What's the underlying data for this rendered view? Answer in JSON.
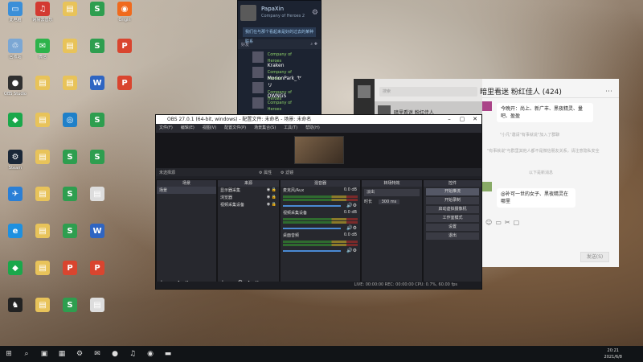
{
  "desktop": {
    "icons": [
      {
        "label": "此电脑",
        "glyph": "▭",
        "color": "#3b8fd8",
        "col": 0,
        "row": 0
      },
      {
        "label": "网易云音乐",
        "glyph": "♫",
        "color": "#d33a31",
        "col": 1,
        "row": 0
      },
      {
        "label": "",
        "glyph": "▤",
        "color": "#e8c35a",
        "col": 2,
        "row": 0
      },
      {
        "label": "",
        "glyph": "S",
        "color": "#2e9e4f",
        "col": 3,
        "row": 0
      },
      {
        "label": "Origin",
        "glyph": "◉",
        "color": "#f06a1d",
        "col": 4,
        "row": 0
      },
      {
        "label": "回收站",
        "glyph": "♲",
        "color": "#7ba7d4",
        "col": 0,
        "row": 1
      },
      {
        "label": "微信",
        "glyph": "✉",
        "color": "#2db34b",
        "col": 1,
        "row": 1
      },
      {
        "label": "",
        "glyph": "▤",
        "color": "#e8c35a",
        "col": 2,
        "row": 1
      },
      {
        "label": "",
        "glyph": "S",
        "color": "#2e9e4f",
        "col": 3,
        "row": 1
      },
      {
        "label": "",
        "glyph": "P",
        "color": "#d9452f",
        "col": 4,
        "row": 1
      },
      {
        "label": "OBS Studio",
        "glyph": "●",
        "color": "#303030",
        "col": 0,
        "row": 2
      },
      {
        "label": "",
        "glyph": "▤",
        "color": "#e8c35a",
        "col": 1,
        "row": 2
      },
      {
        "label": "",
        "glyph": "▤",
        "color": "#e8c35a",
        "col": 2,
        "row": 2
      },
      {
        "label": "",
        "glyph": "W",
        "color": "#2f65c2",
        "col": 3,
        "row": 2
      },
      {
        "label": "",
        "glyph": "P",
        "color": "#d9452f",
        "col": 4,
        "row": 2
      },
      {
        "label": "",
        "glyph": "◆",
        "color": "#1aa84b",
        "col": 0,
        "row": 3
      },
      {
        "label": "",
        "glyph": "▤",
        "color": "#e8c35a",
        "col": 1,
        "row": 3
      },
      {
        "label": "",
        "glyph": "◎",
        "color": "#1f80c9",
        "col": 2,
        "row": 3
      },
      {
        "label": "",
        "glyph": "S",
        "color": "#2e9e4f",
        "col": 3,
        "row": 3
      },
      {
        "label": "Steam",
        "glyph": "⚙",
        "color": "#1b2838",
        "col": 0,
        "row": 4
      },
      {
        "label": "",
        "glyph": "▤",
        "color": "#e8c35a",
        "col": 1,
        "row": 4
      },
      {
        "label": "",
        "glyph": "S",
        "color": "#2e9e4f",
        "col": 2,
        "row": 4
      },
      {
        "label": "",
        "glyph": "S",
        "color": "#2e9e4f",
        "col": 3,
        "row": 4
      },
      {
        "label": "",
        "glyph": "✈",
        "color": "#2a7fd6",
        "col": 0,
        "row": 5
      },
      {
        "label": "",
        "glyph": "▤",
        "color": "#e8c35a",
        "col": 1,
        "row": 5
      },
      {
        "label": "",
        "glyph": "S",
        "color": "#2e9e4f",
        "col": 2,
        "row": 5
      },
      {
        "label": "",
        "glyph": "▤",
        "color": "#dddddd",
        "col": 3,
        "row": 5
      },
      {
        "label": "",
        "glyph": "e",
        "color": "#1e90e0",
        "col": 0,
        "row": 6
      },
      {
        "label": "",
        "glyph": "▤",
        "color": "#e8c35a",
        "col": 1,
        "row": 6
      },
      {
        "label": "",
        "glyph": "S",
        "color": "#2e9e4f",
        "col": 2,
        "row": 6
      },
      {
        "label": "",
        "glyph": "W",
        "color": "#2f65c2",
        "col": 3,
        "row": 6
      },
      {
        "label": "",
        "glyph": "◆",
        "color": "#1aa84b",
        "col": 0,
        "row": 7
      },
      {
        "label": "",
        "glyph": "▤",
        "color": "#e8c35a",
        "col": 1,
        "row": 7
      },
      {
        "label": "",
        "glyph": "P",
        "color": "#d9452f",
        "col": 2,
        "row": 7
      },
      {
        "label": "",
        "glyph": "P",
        "color": "#d9452f",
        "col": 3,
        "row": 7
      },
      {
        "label": "",
        "glyph": "♞",
        "color": "#222222",
        "col": 0,
        "row": 8
      },
      {
        "label": "",
        "glyph": "▤",
        "color": "#e8c35a",
        "col": 1,
        "row": 8
      },
      {
        "label": "",
        "glyph": "S",
        "color": "#2e9e4f",
        "col": 2,
        "row": 8
      },
      {
        "label": "",
        "glyph": "▤",
        "color": "#dddddd",
        "col": 3,
        "row": 8
      }
    ]
  },
  "steam": {
    "username": "PapaXin",
    "status": "Company of Heroes 2",
    "notice": "我们在与那个看起来是好的过去的某种联系",
    "friends_header": "好友",
    "friends": [
      {
        "name": "",
        "game": "Company of Heroes"
      },
      {
        "name": "Kraken",
        "game": "Company of Heroes"
      },
      {
        "name": "MorionPark_ヤリ",
        "game": "Company of Heroes"
      },
      {
        "name": "OWNGS",
        "game": "Company of Heroes"
      }
    ]
  },
  "wechat": {
    "search_placeholder": "搜索",
    "chat_item": "暗里看迷 粉红佳人",
    "title": "暗里看迷 粉红佳人 (424)",
    "msg1": "今晚开：尚上、新广丰、黑夜精灵、量吧、盈盈",
    "sys1": "\"小凡\"邀请\"有事就说\"加入了群聊",
    "sys2": "\"有事就说\"与群里其他人都不是微信朋友关系，请注意隐私安全",
    "sys3": "以下是新消息",
    "msg2": "@补可一世的女子、黑夜精灵在哪里",
    "send_label": "发送(S)"
  },
  "obs": {
    "title": "OBS 27.0.1 (64-bit, windows) - 配置文件: 未命名 - 场景: 未命名",
    "menu": [
      "文件(F)",
      "编辑(E)",
      "视图(V)",
      "配置文件(P)",
      "场景集合(S)",
      "工具(T)",
      "帮助(H)"
    ],
    "no_source": "未选择源",
    "props_label": "属性",
    "filters_label": "滤镜",
    "docks": {
      "scenes": "场景",
      "sources": "来源",
      "mixer": "混音器",
      "transitions": "转场特效",
      "controls": "控件"
    },
    "scene_item": "场景",
    "sources_list": [
      "显示器采集",
      "浏览器",
      "视频采集设备"
    ],
    "mixer_tracks": [
      {
        "name": "麦克风/Aux",
        "db": "0.0 dB"
      },
      {
        "name": "视频采集设备",
        "db": "0.0 dB"
      },
      {
        "name": "桌面音频",
        "db": "0.0 dB"
      }
    ],
    "transition": "淡出",
    "duration_label": "时长",
    "duration_value": "300 ms",
    "controls": [
      "开始推流",
      "开始录制",
      "启动虚拟摄像机",
      "工作室模式",
      "设置",
      "退出"
    ],
    "status": "LIVE: 00:00:00   REC: 00:00:00   CPU: 0.7%, 60.00 fps"
  },
  "taskbar": {
    "time": "20:21",
    "date": "2021/6/8",
    "apps": [
      "⊞",
      "⌕",
      "▣",
      "▦",
      "⚙",
      "✉",
      "●",
      "♫",
      "◉",
      "▬"
    ]
  }
}
